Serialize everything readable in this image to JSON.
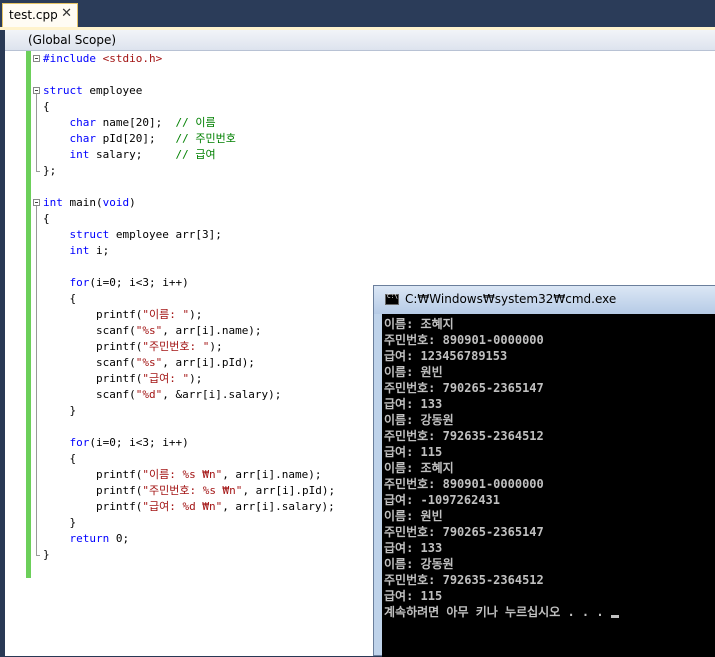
{
  "tab": {
    "label": "test.cpp",
    "close_glyph": "✕"
  },
  "scope": {
    "label": "(Global Scope)"
  },
  "code": [
    [
      {
        "t": "#include ",
        "c": "pp"
      },
      {
        "t": "<stdio.h>",
        "c": "str"
      }
    ],
    [],
    [
      {
        "t": "struct",
        "c": "kw"
      },
      {
        "t": " employee",
        "c": ""
      }
    ],
    [
      {
        "t": "{",
        "c": ""
      }
    ],
    [
      {
        "t": "    char",
        "c": "kw"
      },
      {
        "t": " name[20];  ",
        "c": ""
      },
      {
        "t": "// 이름",
        "c": "cm"
      }
    ],
    [
      {
        "t": "    char",
        "c": "kw"
      },
      {
        "t": " pId[20];   ",
        "c": ""
      },
      {
        "t": "// 주민번호",
        "c": "cm"
      }
    ],
    [
      {
        "t": "    int",
        "c": "kw"
      },
      {
        "t": " salary;     ",
        "c": ""
      },
      {
        "t": "// 급여",
        "c": "cm"
      }
    ],
    [
      {
        "t": "};",
        "c": ""
      }
    ],
    [],
    [
      {
        "t": "int",
        "c": "kw"
      },
      {
        "t": " main(",
        "c": ""
      },
      {
        "t": "void",
        "c": "kw"
      },
      {
        "t": ")",
        "c": ""
      }
    ],
    [
      {
        "t": "{",
        "c": ""
      }
    ],
    [
      {
        "t": "    struct",
        "c": "kw"
      },
      {
        "t": " employee arr[3];",
        "c": ""
      }
    ],
    [
      {
        "t": "    int",
        "c": "kw"
      },
      {
        "t": " i;",
        "c": ""
      }
    ],
    [],
    [
      {
        "t": "    for",
        "c": "kw"
      },
      {
        "t": "(i=0; i<3; i++)",
        "c": ""
      }
    ],
    [
      {
        "t": "    {",
        "c": ""
      }
    ],
    [
      {
        "t": "        printf(",
        "c": ""
      },
      {
        "t": "\"이름: \"",
        "c": "str"
      },
      {
        "t": ");",
        "c": ""
      }
    ],
    [
      {
        "t": "        scanf(",
        "c": ""
      },
      {
        "t": "\"%s\"",
        "c": "str"
      },
      {
        "t": ", arr[i].name);",
        "c": ""
      }
    ],
    [
      {
        "t": "        printf(",
        "c": ""
      },
      {
        "t": "\"주민번호: \"",
        "c": "str"
      },
      {
        "t": ");",
        "c": ""
      }
    ],
    [
      {
        "t": "        scanf(",
        "c": ""
      },
      {
        "t": "\"%s\"",
        "c": "str"
      },
      {
        "t": ", arr[i].pId);",
        "c": ""
      }
    ],
    [
      {
        "t": "        printf(",
        "c": ""
      },
      {
        "t": "\"급여: \"",
        "c": "str"
      },
      {
        "t": ");",
        "c": ""
      }
    ],
    [
      {
        "t": "        scanf(",
        "c": ""
      },
      {
        "t": "\"%d\"",
        "c": "str"
      },
      {
        "t": ", &arr[i].salary);",
        "c": ""
      }
    ],
    [
      {
        "t": "    }",
        "c": ""
      }
    ],
    [],
    [
      {
        "t": "    for",
        "c": "kw"
      },
      {
        "t": "(i=0; i<3; i++)",
        "c": ""
      }
    ],
    [
      {
        "t": "    {",
        "c": ""
      }
    ],
    [
      {
        "t": "        printf(",
        "c": ""
      },
      {
        "t": "\"이름: %s ₩n\"",
        "c": "str"
      },
      {
        "t": ", arr[i].name);",
        "c": ""
      }
    ],
    [
      {
        "t": "        printf(",
        "c": ""
      },
      {
        "t": "\"주민번호: %s ₩n\"",
        "c": "str"
      },
      {
        "t": ", arr[i].pId);",
        "c": ""
      }
    ],
    [
      {
        "t": "        printf(",
        "c": ""
      },
      {
        "t": "\"급여: %d ₩n\"",
        "c": "str"
      },
      {
        "t": ", arr[i].salary);",
        "c": ""
      }
    ],
    [
      {
        "t": "    }",
        "c": ""
      }
    ],
    [
      {
        "t": "    return",
        "c": "kw"
      },
      {
        "t": " 0;",
        "c": ""
      }
    ],
    [
      {
        "t": "}",
        "c": ""
      }
    ]
  ],
  "console": {
    "title": "C:₩Windows₩system32₩cmd.exe",
    "lines": [
      "이름: 조혜지",
      "주민번호: 890901-0000000",
      "급여: 123456789153",
      "이름: 원빈",
      "주민번호: 790265-2365147",
      "급여: 133",
      "이름: 강동원",
      "주민번호: 792635-2364512",
      "급여: 115",
      "이름: 조혜지",
      "주민번호: 890901-0000000",
      "급여: -1097262431",
      "이름: 원빈",
      "주민번호: 790265-2365147",
      "급여: 133",
      "이름: 강동원",
      "주민번호: 792635-2364512",
      "급여: 115",
      "계속하려면 아무 키나 누르십시오 . . . "
    ]
  }
}
